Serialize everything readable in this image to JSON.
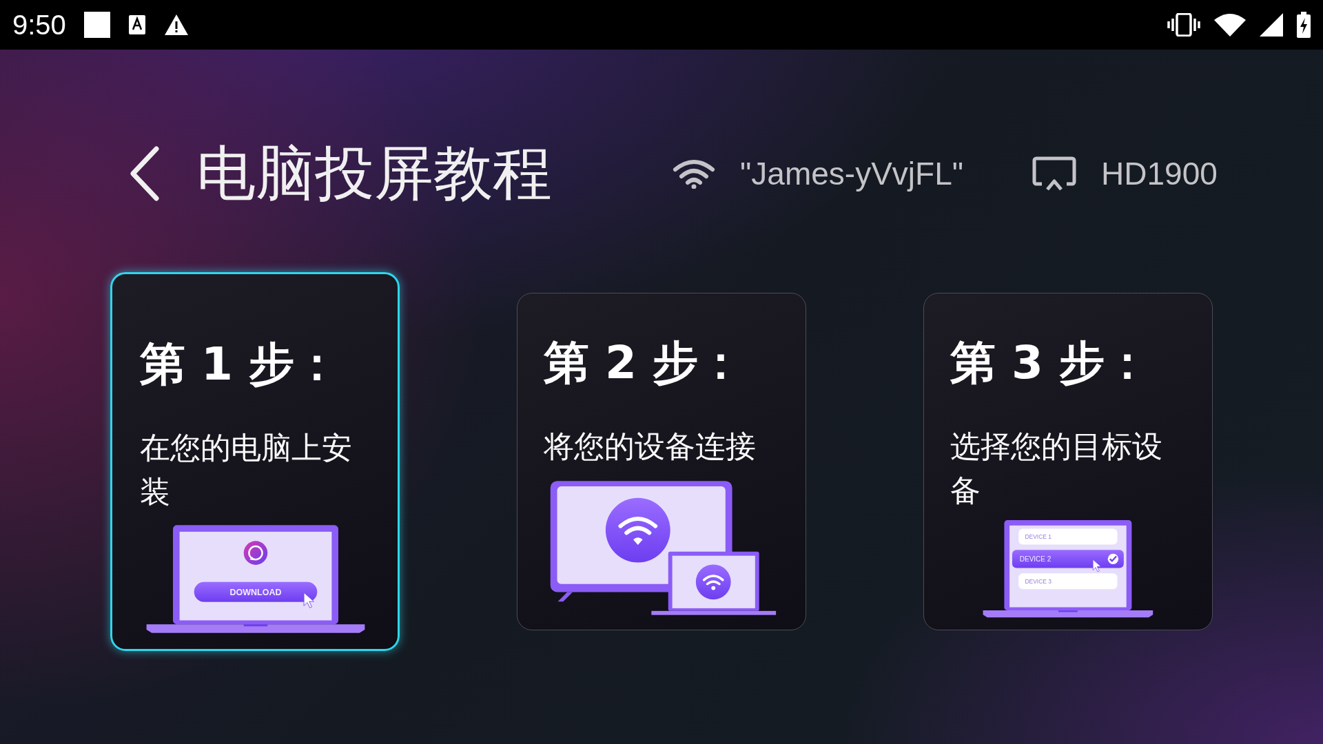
{
  "status_bar": {
    "time": "9:50"
  },
  "header": {
    "title": "电脑投屏教程",
    "network": "\"James-yVvjFL\"",
    "device": "HD1900"
  },
  "steps": [
    {
      "kind": "download",
      "heading": "第 1 步：",
      "description": "在您的电脑上安装",
      "selected": true,
      "button": "DOWNLOAD"
    },
    {
      "kind": "connect",
      "heading": "第 2 步：",
      "description": "将您的设备连接",
      "selected": false
    },
    {
      "kind": "choose",
      "heading": "第 3 步：",
      "description": "选择您的目标设备",
      "selected": false,
      "devices": [
        {
          "label": "DEVICE 1",
          "selected": false
        },
        {
          "label": "DEVICE 2",
          "selected": true
        },
        {
          "label": "DEVICE 3",
          "selected": false
        }
      ]
    }
  ]
}
